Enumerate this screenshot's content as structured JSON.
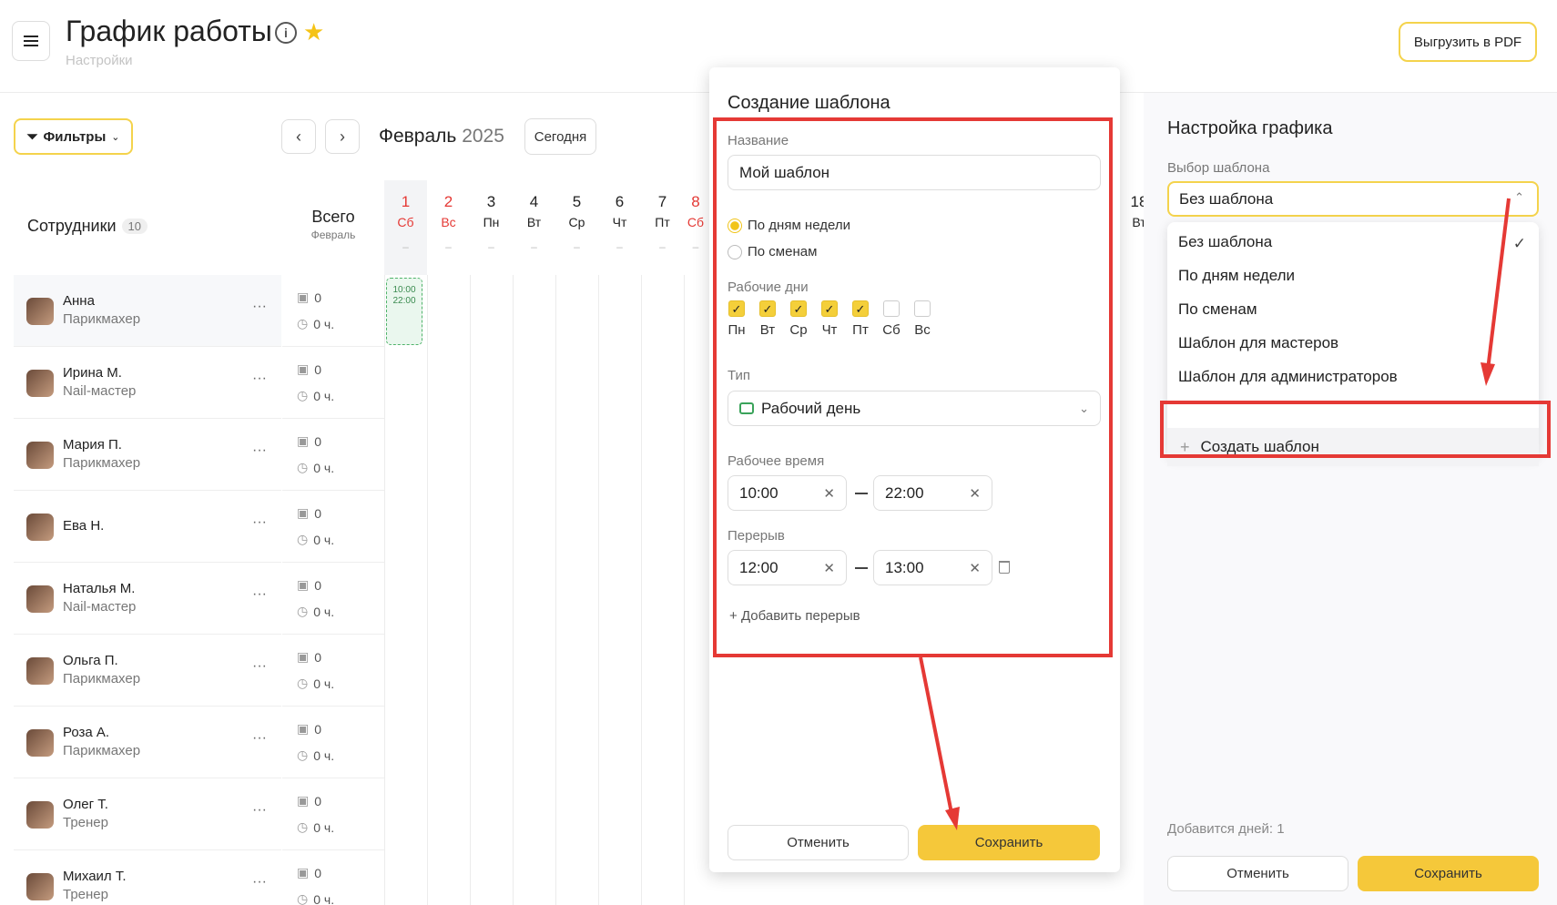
{
  "header": {
    "title": "График работы",
    "subtitle": "Настройки",
    "pdf_label": "Выгрузить в PDF"
  },
  "toolbar": {
    "filters_label": "Фильтры",
    "month": "Февраль",
    "year": "2025",
    "today_label": "Сегодня",
    "prev": "‹",
    "next": "›"
  },
  "table": {
    "employees_label": "Сотрудники",
    "employees_count": "10",
    "total_label": "Всего",
    "total_sub": "Февраль",
    "days": [
      {
        "num": "1",
        "dow": "Сб",
        "weekend": true
      },
      {
        "num": "2",
        "dow": "Вс",
        "weekend": true
      },
      {
        "num": "3",
        "dow": "Пн",
        "weekend": false
      },
      {
        "num": "4",
        "dow": "Вт",
        "weekend": false
      },
      {
        "num": "5",
        "dow": "Ср",
        "weekend": false
      },
      {
        "num": "6",
        "dow": "Чт",
        "weekend": false
      },
      {
        "num": "7",
        "dow": "Пт",
        "weekend": false
      },
      {
        "num": "8",
        "dow": "Сб",
        "weekend": true
      }
    ],
    "day_dash": "–",
    "edge_day": {
      "num": "18",
      "dow": "Вт"
    },
    "shift": {
      "start": "10:00",
      "end": "22:00"
    },
    "employees": [
      {
        "name": "Анна",
        "role": "Парикмахер",
        "shifts": "0",
        "hours": "0 ч."
      },
      {
        "name": "Ирина М.",
        "role": "Nail-мастер",
        "shifts": "0",
        "hours": "0 ч."
      },
      {
        "name": "Мария П.",
        "role": "Парикмахер",
        "shifts": "0",
        "hours": "0 ч."
      },
      {
        "name": "Ева Н.",
        "role": "",
        "shifts": "0",
        "hours": "0 ч."
      },
      {
        "name": "Наталья М.",
        "role": "Nail-мастер",
        "shifts": "0",
        "hours": "0 ч."
      },
      {
        "name": "Ольга П.",
        "role": "Парикмахер",
        "shifts": "0",
        "hours": "0 ч."
      },
      {
        "name": "Роза А.",
        "role": "Парикмахер",
        "shifts": "0",
        "hours": "0 ч."
      },
      {
        "name": "Олег Т.",
        "role": "Тренер",
        "shifts": "0",
        "hours": "0 ч."
      },
      {
        "name": "Михаил Т.",
        "role": "Тренер",
        "shifts": "0",
        "hours": "0 ч."
      }
    ]
  },
  "modal": {
    "title": "Создание шаблона",
    "name_label": "Название",
    "name_value": "Мой шаблон",
    "radio_by_days": "По дням недели",
    "radio_by_shifts": "По сменам",
    "workdays_label": "Рабочие дни",
    "workdays": [
      {
        "label": "Пн",
        "checked": true
      },
      {
        "label": "Вт",
        "checked": true
      },
      {
        "label": "Ср",
        "checked": true
      },
      {
        "label": "Чт",
        "checked": true
      },
      {
        "label": "Пт",
        "checked": true
      },
      {
        "label": "Сб",
        "checked": false
      },
      {
        "label": "Вс",
        "checked": false
      }
    ],
    "type_label": "Тип",
    "type_value": "Рабочий день",
    "worktime_label": "Рабочее время",
    "work_start": "10:00",
    "work_end": "22:00",
    "break_label": "Перерыв",
    "break_start": "12:00",
    "break_end": "13:00",
    "add_break": "Добавить перерыв",
    "cancel_label": "Отменить",
    "save_label": "Сохранить"
  },
  "panel": {
    "title": "Настройка графика",
    "template_label": "Выбор шаблона",
    "selected": "Без шаблона",
    "options": [
      "Без шаблона",
      "По дням недели",
      "По сменам",
      "Шаблон для мастеров",
      "Шаблон для администраторов"
    ],
    "create_label": "Создать шаблон",
    "days_added": "Добавится дней: 1",
    "cancel_label": "Отменить",
    "save_label": "Сохранить"
  },
  "colors": {
    "accent": "#f5c83a",
    "annotation_red": "#e53935",
    "weekend_red": "#e53935",
    "success_green": "#3aa35a"
  }
}
